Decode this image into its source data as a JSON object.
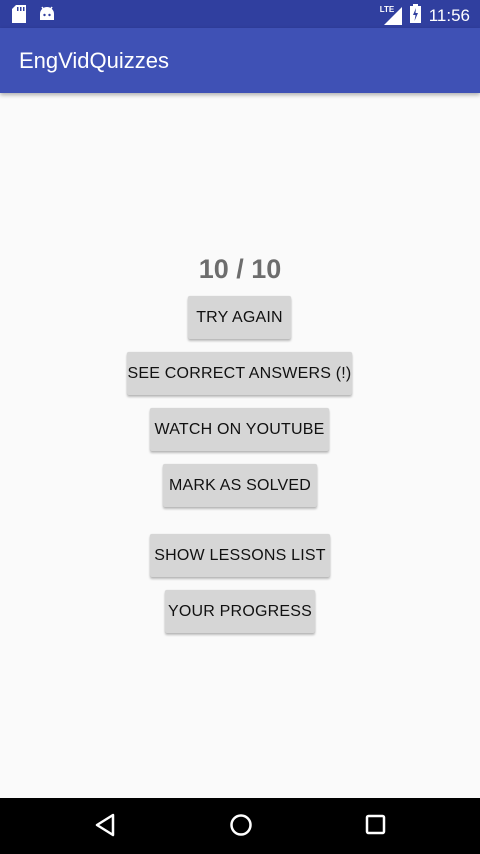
{
  "status_bar": {
    "time": "11:56",
    "network_label": "LTE",
    "icons": [
      "sd-card-icon",
      "android-icon",
      "signal-icon",
      "battery-charging-icon"
    ]
  },
  "app_bar": {
    "title": "EngVidQuizzes"
  },
  "result": {
    "score": "10 / 10"
  },
  "buttons": {
    "try_again": "TRY AGAIN",
    "see_correct_answers": "SEE CORRECT ANSWERS (!)",
    "watch_on_youtube": "WATCH ON YOUTUBE",
    "mark_as_solved": "MARK AS SOLVED",
    "show_lessons_list": "SHOW LESSONS LIST",
    "your_progress": "YOUR PROGRESS"
  },
  "nav_bar": {
    "items": [
      "back-icon",
      "home-icon",
      "recents-icon"
    ]
  }
}
